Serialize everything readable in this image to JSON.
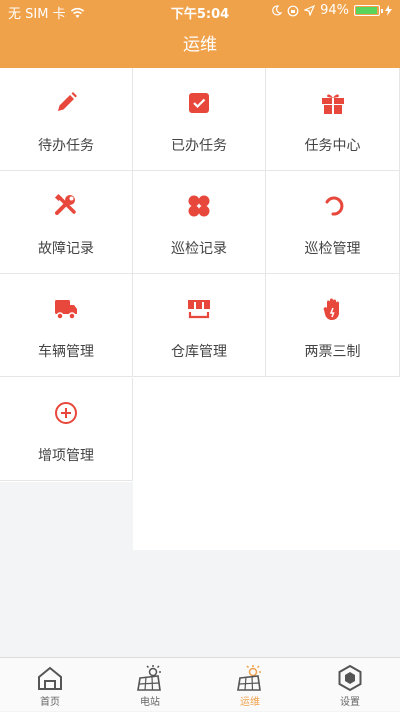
{
  "status_bar": {
    "carrier": "无 SIM 卡",
    "time": "下午5:04",
    "battery": "94%",
    "battery_level": 0.94
  },
  "nav": {
    "title": "运维"
  },
  "accent_color": "#f0a24b",
  "icon_color": "#e8473b",
  "menu": [
    {
      "label": "待办任务",
      "icon": "pencil-icon"
    },
    {
      "label": "已办任务",
      "icon": "checkbox-icon"
    },
    {
      "label": "任务中心",
      "icon": "gift-icon"
    },
    {
      "label": "故障记录",
      "icon": "wrench-screwdriver-icon"
    },
    {
      "label": "巡检记录",
      "icon": "four-circles-icon"
    },
    {
      "label": "巡检管理",
      "icon": "loading-arc-icon"
    },
    {
      "label": "车辆管理",
      "icon": "truck-icon"
    },
    {
      "label": "仓库管理",
      "icon": "warehouse-icon"
    },
    {
      "label": "两票三制",
      "icon": "hand-icon"
    },
    {
      "label": "增项管理",
      "icon": "plus-circle-icon"
    }
  ],
  "tabs": [
    {
      "label": "首页",
      "icon": "home-icon"
    },
    {
      "label": "电站",
      "icon": "solar-station-icon"
    },
    {
      "label": "运维",
      "icon": "solar-station-icon",
      "active": true
    },
    {
      "label": "设置",
      "icon": "hexagon-settings-icon"
    }
  ]
}
